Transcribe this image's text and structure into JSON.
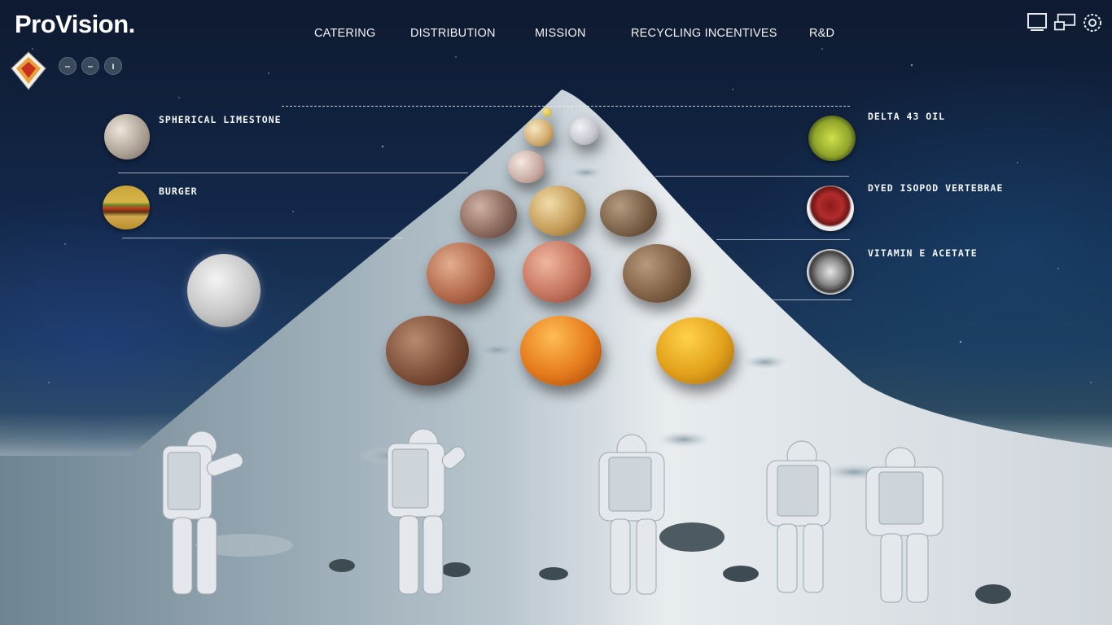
{
  "brand": {
    "name": "ProVision."
  },
  "header": {
    "dots": [
      "–",
      "–",
      "ı"
    ],
    "nav": [
      "CATERING",
      "DISTRIBUTION",
      "MISSION",
      "RECYCLING INCENTIVES",
      "R&D"
    ],
    "icons": [
      "monitor-icon",
      "multi-screen-icon",
      "settings-gear-icon"
    ]
  },
  "items_left": [
    {
      "label": "SPHERICAL LIMESTONE",
      "icon": "limestone-sphere-thumb"
    },
    {
      "label": "BURGER",
      "icon": "burger-thumb"
    }
  ],
  "items_right": [
    {
      "label": "DELTA 43 OIL",
      "icon": "oil-dish-thumb"
    },
    {
      "label": "DYED ISOPOD VERTEBRAE",
      "icon": "isopod-dish-thumb"
    },
    {
      "label": "VITAMIN E ACETATE",
      "icon": "acetate-dish-thumb"
    }
  ],
  "colors": {
    "sky_top": "#0e1a30",
    "sky_mid": "#1b3a5c",
    "ground": "#dfe5e9",
    "logo_orange": "#e8a13a",
    "logo_red": "#c8321e"
  }
}
